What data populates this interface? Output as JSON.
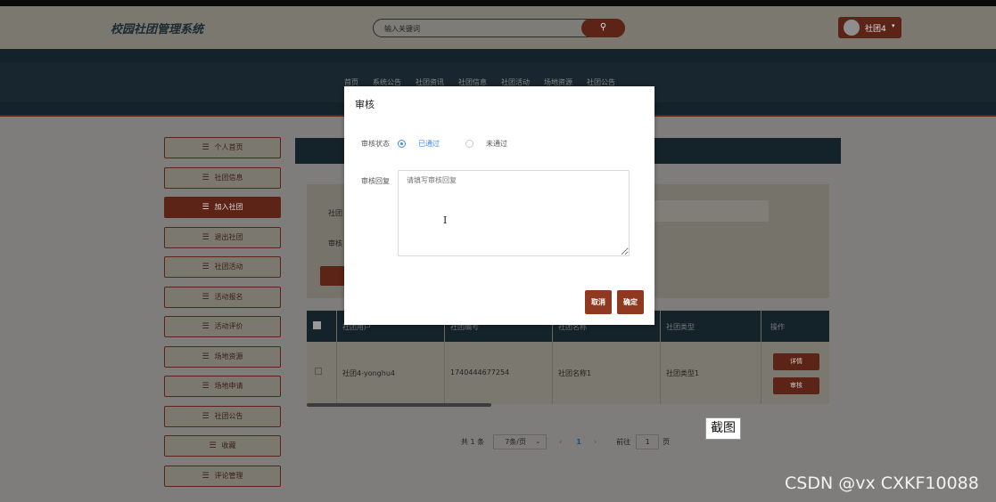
{
  "header": {
    "logo": "校园社团管理系统",
    "search_placeholder": "输入关键词",
    "user_name": "社团4",
    "caret": "▾"
  },
  "nav": {
    "items": [
      "首页",
      "系统公告",
      "社团资讯",
      "社团信息",
      "社团活动",
      "场地资源",
      "社团公告"
    ]
  },
  "sidebar": {
    "items": [
      {
        "label": "个人首页"
      },
      {
        "label": "社团信息"
      },
      {
        "label": "加入社团"
      },
      {
        "label": "退出社团"
      },
      {
        "label": "社团活动"
      },
      {
        "label": "活动报名"
      },
      {
        "label": "活动评价"
      },
      {
        "label": "场地资源"
      },
      {
        "label": "场地申请"
      },
      {
        "label": "社团公告"
      },
      {
        "label": "收藏"
      },
      {
        "label": "评论管理"
      }
    ]
  },
  "filter": {
    "label1": "社团",
    "label2": "审核"
  },
  "table": {
    "headers": [
      "社团用户",
      "社团编号",
      "社团名称",
      "社团类型",
      "操作"
    ],
    "rows": [
      {
        "user": "社团4-yonghu4",
        "number": "1740444677254",
        "name": "社团名称1",
        "type": "社团类型1"
      }
    ],
    "detail_button": "详情",
    "review_button": "审核"
  },
  "pager": {
    "total": "共 1 条",
    "page_size": "7条/页",
    "prev": "‹",
    "current": "1",
    "next": "›",
    "goto_label": "前往",
    "goto_value": "1",
    "unit": "页"
  },
  "modal": {
    "title": "审核",
    "status_label": "审核状态",
    "option_passed": "已通过",
    "option_failed": "未通过",
    "reply_label": "审核回复",
    "reply_placeholder": "请填写审核回复",
    "cancel": "取消",
    "confirm": "确定"
  },
  "overlay": {
    "screenshot_label": "截图",
    "watermark": "CSDN @vx  CXKF10088"
  },
  "colors": {
    "accent": "#5b2416",
    "dark": "#14222a",
    "radio_checked": "#3f8ae8"
  }
}
